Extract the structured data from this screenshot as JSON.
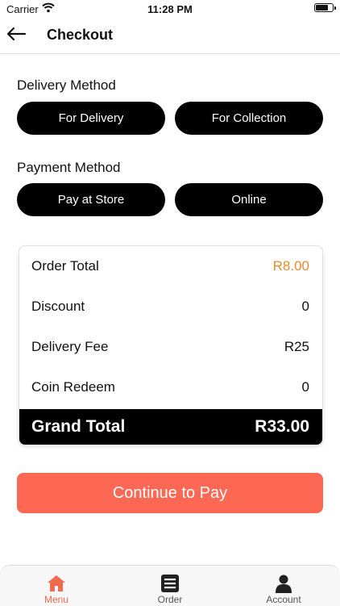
{
  "status_bar": {
    "carrier": "Carrier",
    "time": "11:28 PM"
  },
  "header": {
    "title": "Checkout"
  },
  "delivery": {
    "label": "Delivery Method",
    "options": [
      "For Delivery",
      "For Collection"
    ]
  },
  "payment": {
    "label": "Payment Method",
    "options": [
      "Pay at Store",
      "Online"
    ]
  },
  "summary": {
    "rows": [
      {
        "label": "Order Total",
        "value": "R8.00"
      },
      {
        "label": "Discount",
        "value": "0"
      },
      {
        "label": "Delivery Fee",
        "value": "R25"
      },
      {
        "label": "Coin Redeem",
        "value": "0"
      }
    ],
    "grand_total": {
      "label": "Grand Total",
      "value": "R33.00"
    }
  },
  "continue_button": {
    "label": "Continue to Pay"
  },
  "tab_bar": {
    "tabs": [
      {
        "label": "Menu",
        "icon": "home-icon",
        "active": true
      },
      {
        "label": "Order",
        "icon": "list-icon",
        "active": false
      },
      {
        "label": "Account",
        "icon": "user-icon",
        "active": false
      }
    ]
  },
  "colors": {
    "accent": "#fd6854",
    "highlight_value": "#e88b2e",
    "active_tab": "#f06a4e",
    "pill": "#000000"
  }
}
